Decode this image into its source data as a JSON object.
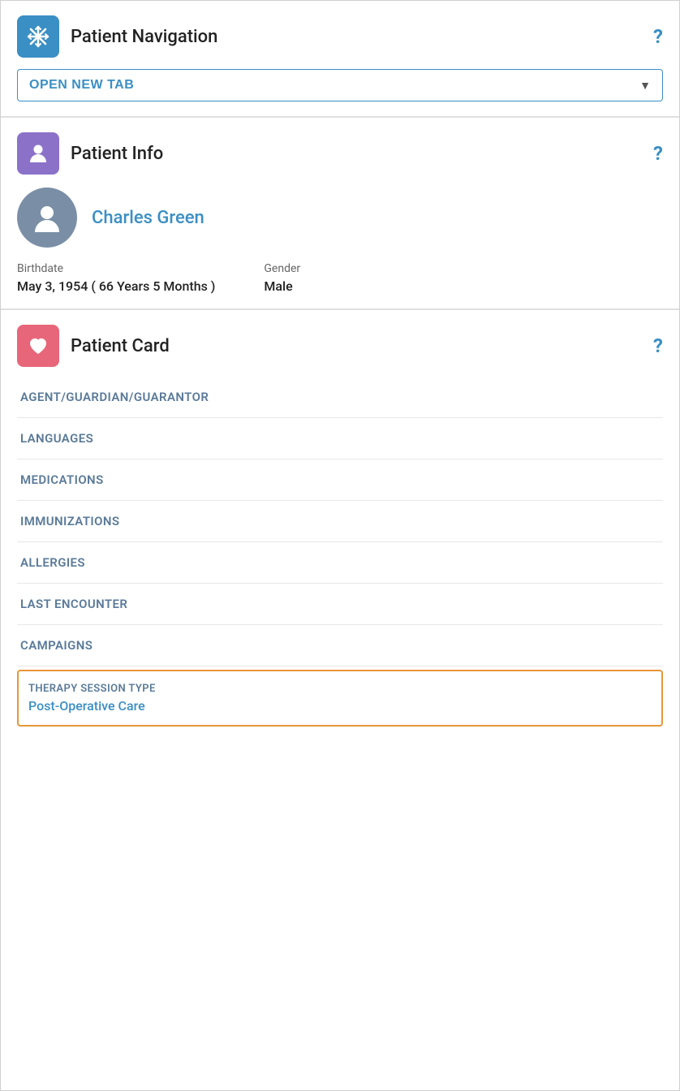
{
  "app": {
    "title": "Patient Navigation"
  },
  "nav_section": {
    "title": "Patient Navigation",
    "help_label": "?",
    "open_new_tab_label": "OPEN NEW TAB"
  },
  "patient_info_section": {
    "title": "Patient Info",
    "help_label": "?",
    "patient_name": "Charles Green",
    "birthdate_label": "Birthdate",
    "birthdate_value": "May 3, 1954 ( 66 Years 5 Months )",
    "gender_label": "Gender",
    "gender_value": "Male"
  },
  "patient_card_section": {
    "title": "Patient Card",
    "help_label": "?",
    "menu_items": [
      {
        "label": "AGENT/GUARDIAN/GUARANTOR"
      },
      {
        "label": "LANGUAGES"
      },
      {
        "label": "MEDICATIONS"
      },
      {
        "label": "IMMUNIZATIONS"
      },
      {
        "label": "ALLERGIES"
      },
      {
        "label": "LAST ENCOUNTER"
      },
      {
        "label": "CAMPAIGNS"
      }
    ],
    "highlighted_item": {
      "sublabel": "THERAPY SESSION TYPE",
      "value": "Post-Operative Care"
    }
  },
  "colors": {
    "blue_accent": "#3a8fc4",
    "purple_icon": "#8b72c8",
    "red_icon": "#e8667a",
    "orange_border": "#e8973a",
    "avatar_bg": "#7a8fa6",
    "menu_text": "#5a7a9a"
  }
}
